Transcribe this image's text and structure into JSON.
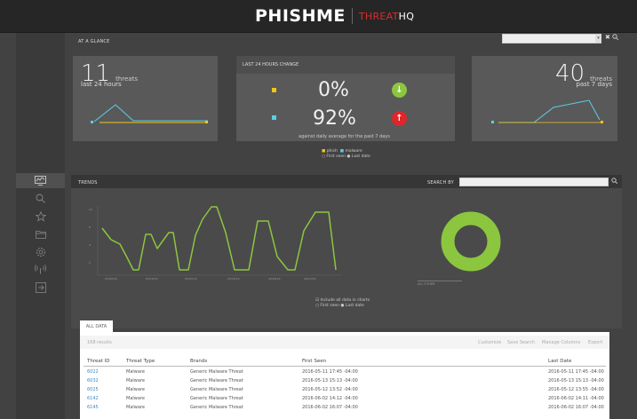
{
  "header": {
    "logo_main": "PHISHME",
    "logo_sub_a": "THREAT",
    "logo_sub_b": "HQ"
  },
  "glance": {
    "title": "AT A GLANCE",
    "left_card": {
      "count": "11",
      "count_label": "threats",
      "period": "last 24 hours"
    },
    "middle_card": {
      "title": "LAST 24 HOURS CHANGE",
      "phish_pct": "0%",
      "malware_pct": "92%",
      "note": "against daily average for the past 7 days"
    },
    "right_card": {
      "count": "40",
      "count_label": "threats",
      "period": "past 7 days"
    },
    "legend": {
      "phish": "phish",
      "malware": "malware",
      "first_seen": "First seen",
      "last_date": "Last date"
    },
    "colors": {
      "phish": "#f5c518",
      "malware": "#5ad0e6",
      "down": "#8cc63f",
      "up": "#e0252b"
    }
  },
  "trends": {
    "title": "TRENDS",
    "search_label": "SEARCH BY",
    "legend": {
      "include": "Include all data in charts",
      "first_seen": "First seen",
      "last_date": "Last date"
    },
    "donut_label": "ALL OTHER",
    "chart_color": "#8cc63f"
  },
  "table": {
    "tab": "ALL DATA",
    "results": "168 results",
    "actions": [
      "Customize",
      "Save Search",
      "Manage Columns",
      "Export"
    ],
    "columns": [
      "Threat ID",
      "Threat Type",
      "Brands",
      "First Seen",
      "Last Date"
    ],
    "rows": [
      [
        "6022",
        "Malware",
        "Generic Malware Threat",
        "2016-05-11 17:45 -04:00",
        "2016-05-11 17:45 -04:00"
      ],
      [
        "6032",
        "Malware",
        "Generic Malware Threat",
        "2016-05-13 15:13 -04:00",
        "2016-05-13 15:13 -04:00"
      ],
      [
        "6025",
        "Malware",
        "Generic Malware Threat",
        "2016-05-12 13:52 -04:00",
        "2016-05-12 13:55 -04:00"
      ],
      [
        "6142",
        "Malware",
        "Generic Malware Threat",
        "2016-06-02 14:12 -04:00",
        "2016-06-02 14:11 -04:00"
      ],
      [
        "6145",
        "Malware",
        "Generic Malware Threat",
        "2016-06-02 16:07 -04:00",
        "2016-06-02 16:07 -04:00"
      ]
    ]
  },
  "sidebar_icons": [
    "chart-icon",
    "search-icon",
    "star-icon",
    "folder-icon",
    "settings-icon",
    "broadcast-icon",
    "export-icon"
  ]
}
